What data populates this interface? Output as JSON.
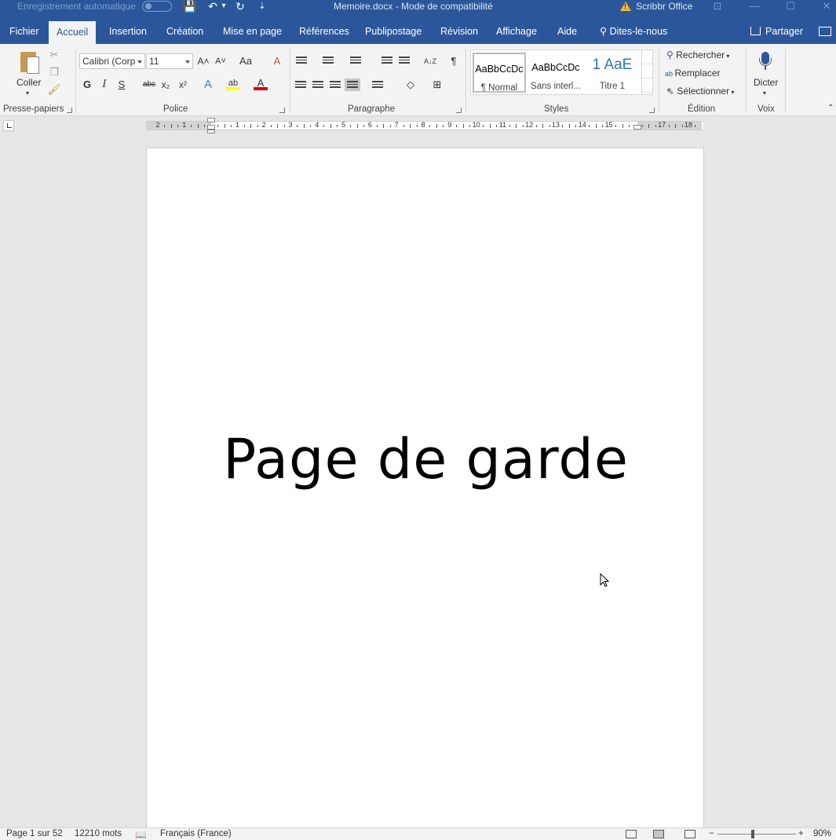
{
  "titlebar": {
    "autosave_label": "Enregistrement automatique",
    "document_title": "Memoire.docx  -  Mode de compatibilité",
    "office_user": "Scribbr Office",
    "qat": {
      "save": "💾",
      "undo": "↶",
      "undo_dropdown": "▾",
      "redo": "↻",
      "customize": "⇣"
    },
    "window_buttons": {
      "ribbon_display": "⊡",
      "minimize": "—",
      "maximize": "☐",
      "close": "✕"
    }
  },
  "menu": {
    "items": [
      "Fichier",
      "Accueil",
      "Insertion",
      "Création",
      "Mise en page",
      "Références",
      "Publipostage",
      "Révision",
      "Affichage",
      "Aide"
    ],
    "tell_me": "Dites-le-nous",
    "share": "Partager"
  },
  "ribbon": {
    "clipboard": {
      "paste_label": "Coller",
      "group_label": "Presse-papiers"
    },
    "font": {
      "font_name": "Calibri (Corp",
      "font_size": "11",
      "group_label": "Police",
      "grow": "A˄",
      "shrink": "A˅",
      "case": "Aa",
      "clear": "A",
      "bold": "G",
      "italic": "I",
      "underline": "S",
      "strike": "abc",
      "sub": "x₂",
      "sup": "x²",
      "effects": "A",
      "highlight": "ab",
      "color": "A"
    },
    "paragraph": {
      "group_label": "Paragraphe",
      "sort": "A↓Z",
      "pilcrow": "¶"
    },
    "styles": {
      "group_label": "Styles",
      "items": [
        {
          "sample": "AaBbCcDc",
          "name": "¶ Normal"
        },
        {
          "sample": "AaBbCcDc",
          "name": "Sans interl..."
        },
        {
          "sample": "1  AaE",
          "name": "Titre 1"
        }
      ]
    },
    "editing": {
      "group_label": "Édition",
      "find": "Rechercher",
      "replace": "Remplacer",
      "select": "Sélectionner"
    },
    "voice": {
      "group_label": "Voix",
      "dictate": "Dicter"
    }
  },
  "ruler": {
    "numbers": [
      "2",
      "1",
      "",
      "1",
      "2",
      "3",
      "4",
      "5",
      "6",
      "7",
      "8",
      "9",
      "10",
      "11",
      "12",
      "13",
      "14",
      "15",
      "",
      "17",
      "18"
    ]
  },
  "document": {
    "heading": "Page de garde"
  },
  "status": {
    "page": "Page 1 sur 52",
    "words": "12210 mots",
    "language": "Français (France)",
    "zoom_minus": "−",
    "zoom_plus": "+",
    "zoom": "90%"
  },
  "colors": {
    "accent": "#2b579a",
    "ribbon_bg": "#f3f3f3",
    "canvas_bg": "#e6e6e6"
  }
}
